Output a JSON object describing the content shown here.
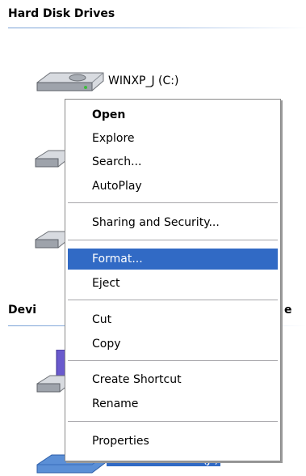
{
  "groups": {
    "hard_disk_drives": "Hard Disk Drives",
    "devices_removable_left": "Devi",
    "devices_removable_right": "e"
  },
  "drives": {
    "c_label": "WINXP_J (C:)",
    "j_label": "Removable Disk (J:)"
  },
  "context_menu": {
    "open": "Open",
    "explore": "Explore",
    "search": "Search...",
    "autoplay": "AutoPlay",
    "sharing": "Sharing and Security...",
    "format": "Format...",
    "eject": "Eject",
    "cut": "Cut",
    "copy": "Copy",
    "create_shortcut": "Create Shortcut",
    "rename": "Rename",
    "properties": "Properties"
  },
  "colors": {
    "highlight": "#316ac5",
    "header_rule": "#7aa2d6",
    "separator": "#a7a6aa"
  }
}
